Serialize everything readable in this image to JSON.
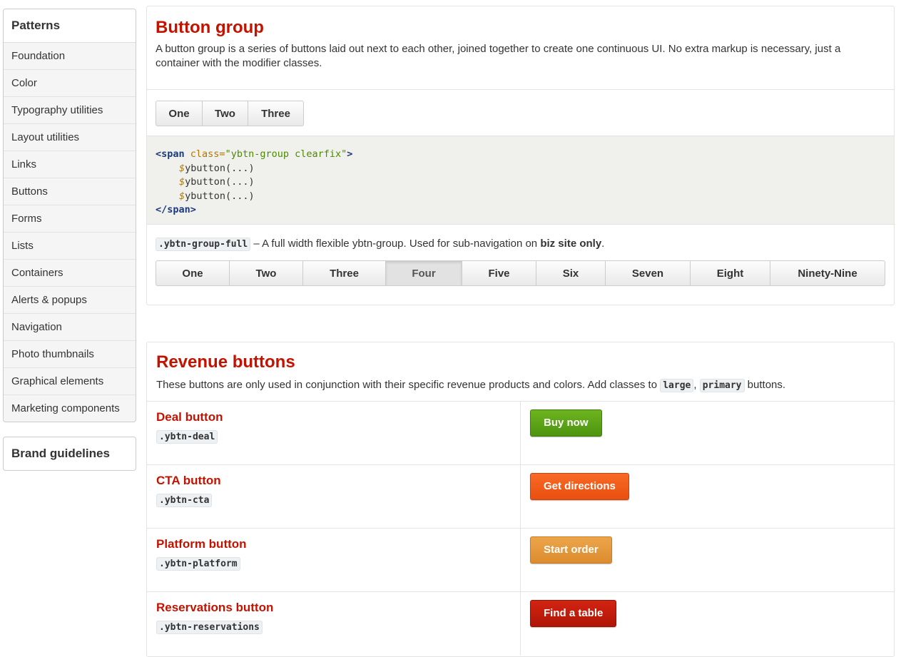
{
  "sidebar": {
    "heading": "Patterns",
    "items": [
      "Foundation",
      "Color",
      "Typography utilities",
      "Layout utilities",
      "Links",
      "Buttons",
      "Forms",
      "Lists",
      "Containers",
      "Alerts & popups",
      "Navigation",
      "Photo thumbnails",
      "Graphical elements",
      "Marketing components"
    ],
    "brand": "Brand guidelines"
  },
  "button_group": {
    "title": "Button group",
    "description": "A button group is a series of buttons laid out next to each other, joined together to create one continuous UI. No extra markup is necessary, just a container with the modifier classes.",
    "buttons": [
      "One",
      "Two",
      "Three"
    ],
    "code": {
      "open_tag": "<span",
      "attr": "class=",
      "attr_value": "\"ybtn-group clearfix\"",
      "open_close": ">",
      "lines": [
        "ybutton(...)",
        "ybutton(...)",
        "ybutton(...)"
      ],
      "var_prefix": "$",
      "close_tag": "</span>"
    },
    "full": {
      "class": ".ybtn-group-full",
      "text_before": " – A full width flexible ybtn-group. Used for sub-navigation on ",
      "bold": "biz site only",
      "text_after": ".",
      "buttons": [
        "One",
        "Two",
        "Three",
        "Four",
        "Five",
        "Six",
        "Seven",
        "Eight",
        "Ninety-Nine"
      ],
      "active_index": 3
    }
  },
  "revenue": {
    "title": "Revenue buttons",
    "description_before": "These buttons are only used in conjunction with their specific revenue products and colors. Add classes to ",
    "class_large": "large",
    "separator": ", ",
    "class_primary": "primary",
    "description_after": " buttons.",
    "rows": [
      {
        "name": "Deal button",
        "class": ".ybtn-deal",
        "button": "Buy now",
        "color": "#5aa214"
      },
      {
        "name": "CTA button",
        "class": ".ybtn-cta",
        "button": "Get directions",
        "color": "#f4581a"
      },
      {
        "name": "Platform button",
        "class": ".ybtn-platform",
        "button": "Start order",
        "color": "#e49838"
      },
      {
        "name": "Reservations button",
        "class": ".ybtn-reservations",
        "button": "Find a table",
        "color": "#c01b0b"
      }
    ]
  }
}
